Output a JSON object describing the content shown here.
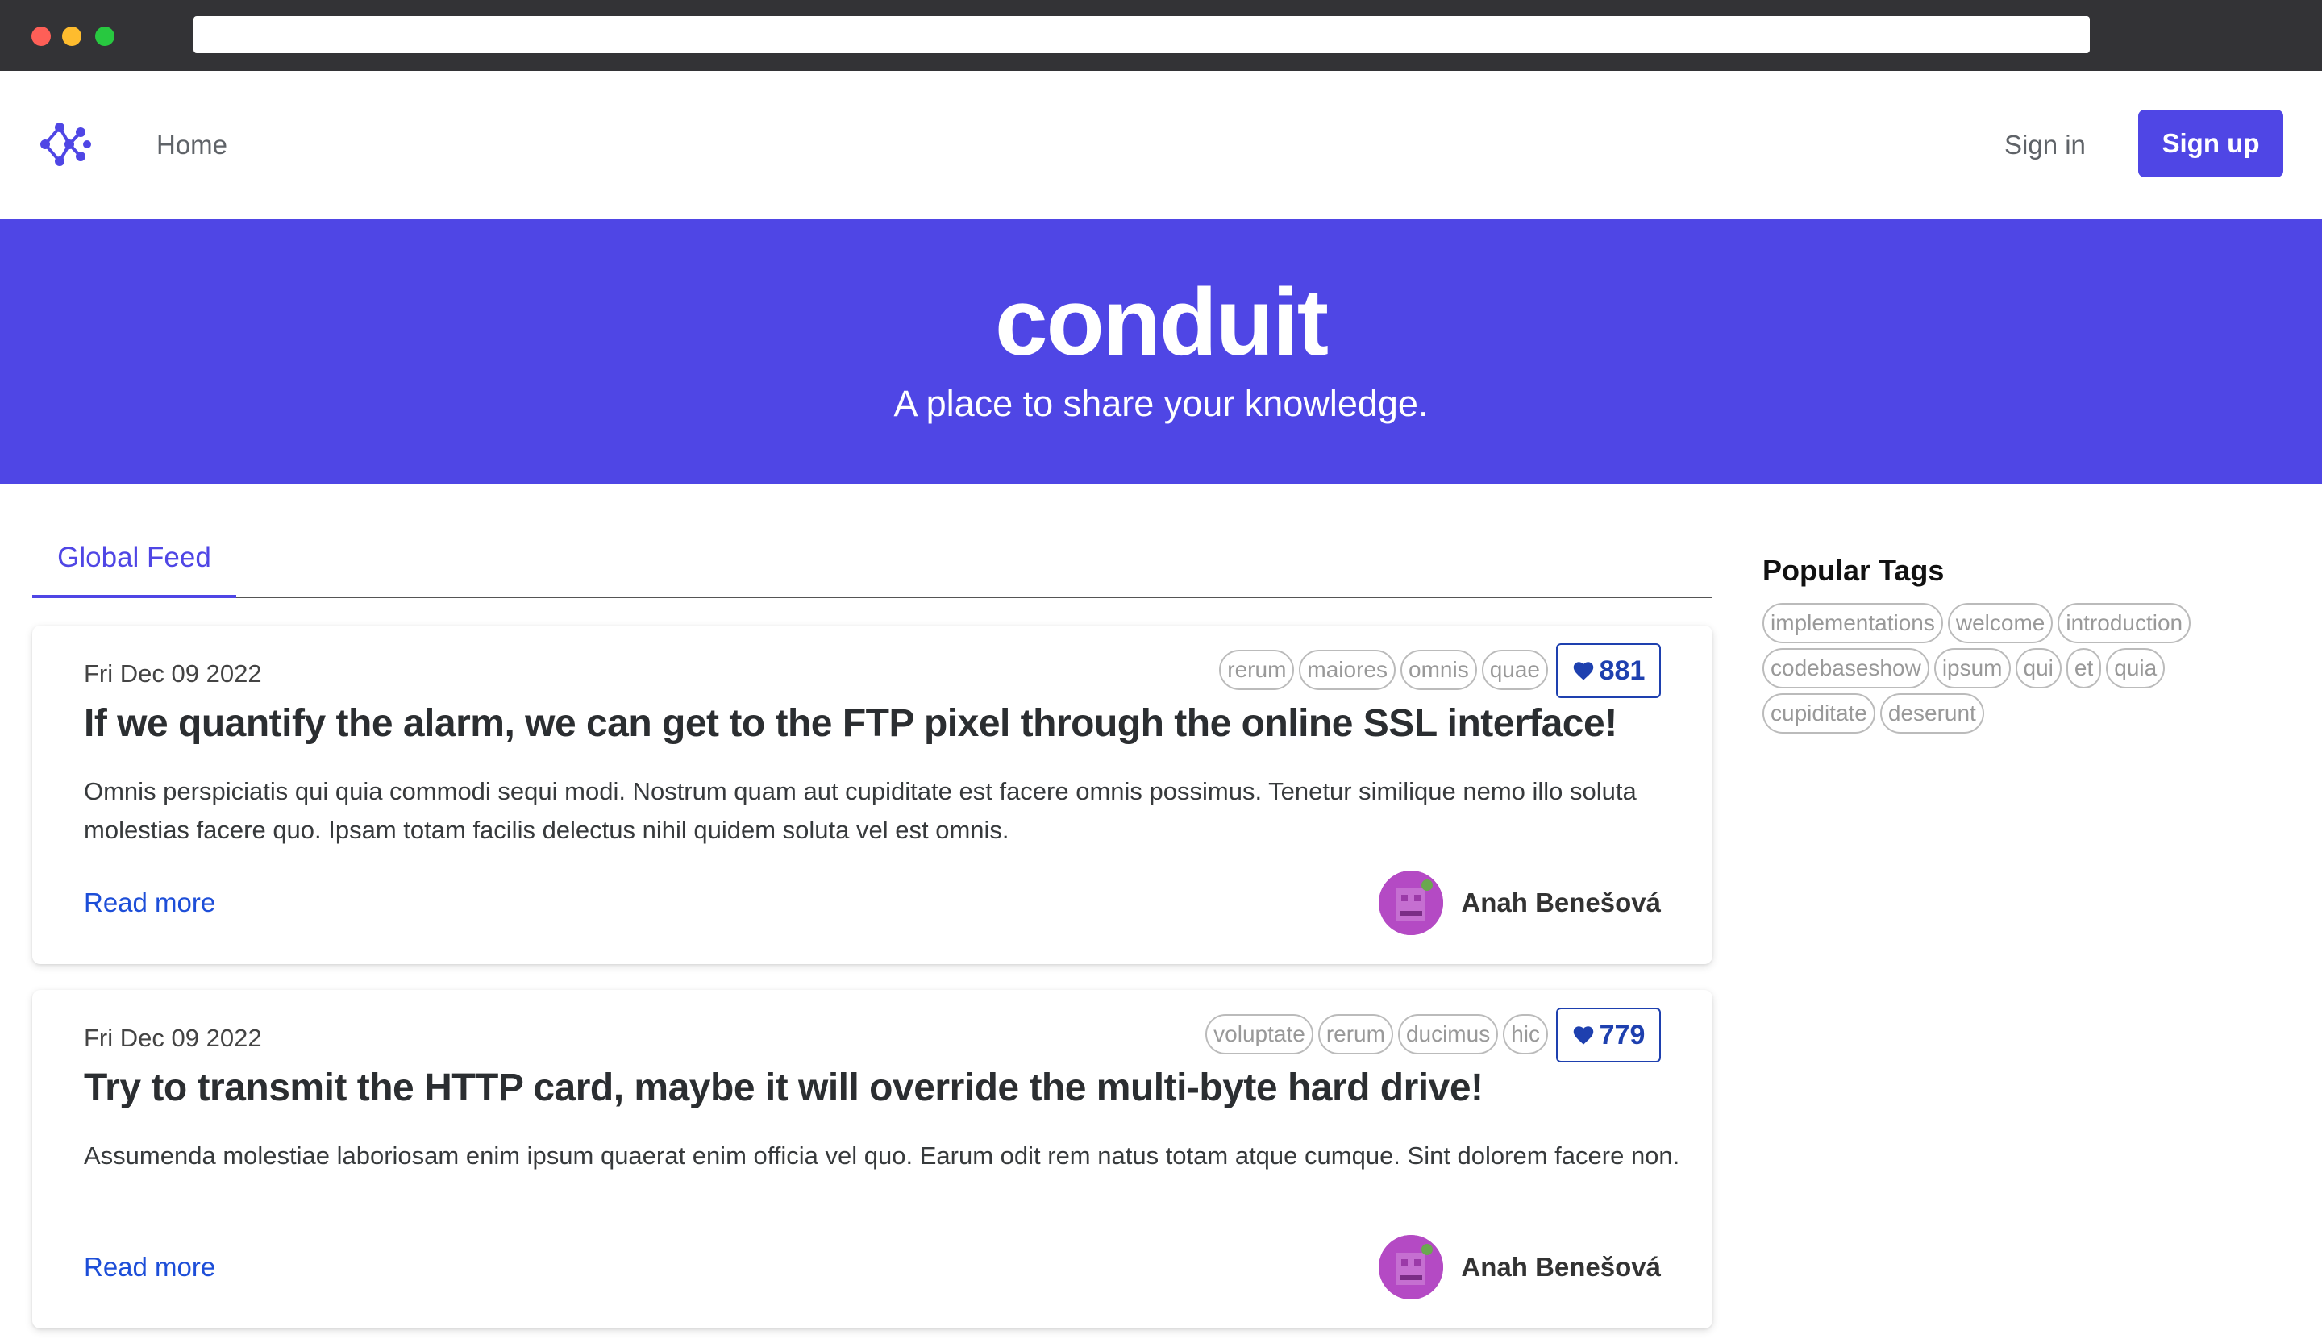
{
  "nav": {
    "home_label": "Home",
    "signin_label": "Sign in",
    "signup_label": "Sign up",
    "logo_icon": "conduit-logo-icon"
  },
  "banner": {
    "title": "conduit",
    "subtitle": "A place to share your knowledge."
  },
  "feed": {
    "tab_label": "Global Feed"
  },
  "articles": [
    {
      "date": "Fri Dec 09 2022",
      "tags": [
        "rerum",
        "maiores",
        "omnis",
        "quae"
      ],
      "likes": "881",
      "title": "If we quantify the alarm, we can get to the FTP pixel through the online SSL interface!",
      "description": "Omnis perspiciatis qui quia commodi sequi modi. Nostrum quam aut cupiditate est facere omnis possimus. Tenetur similique nemo illo soluta molestias facere quo. Ipsam totam facilis delectus nihil quidem soluta vel est omnis.",
      "read_more": "Read more",
      "author": "Anah Benešová"
    },
    {
      "date": "Fri Dec 09 2022",
      "tags": [
        "voluptate",
        "rerum",
        "ducimus",
        "hic"
      ],
      "likes": "779",
      "title": "Try to transmit the HTTP card, maybe it will override the multi-byte hard drive!",
      "description": "Assumenda molestiae laboriosam enim ipsum quaerat enim officia vel quo. Earum odit rem natus totam atque cumque. Sint dolorem facere non.",
      "read_more": "Read more",
      "author": "Anah Benešová"
    }
  ],
  "sidebar": {
    "title": "Popular Tags",
    "tags": [
      "implementations",
      "welcome",
      "introduction",
      "codebaseshow",
      "ipsum",
      "qui",
      "et",
      "quia",
      "cupiditate",
      "deserunt"
    ]
  },
  "colors": {
    "brand": "#4f46e5",
    "link": "#1d4ed8",
    "like": "#1e40af"
  }
}
